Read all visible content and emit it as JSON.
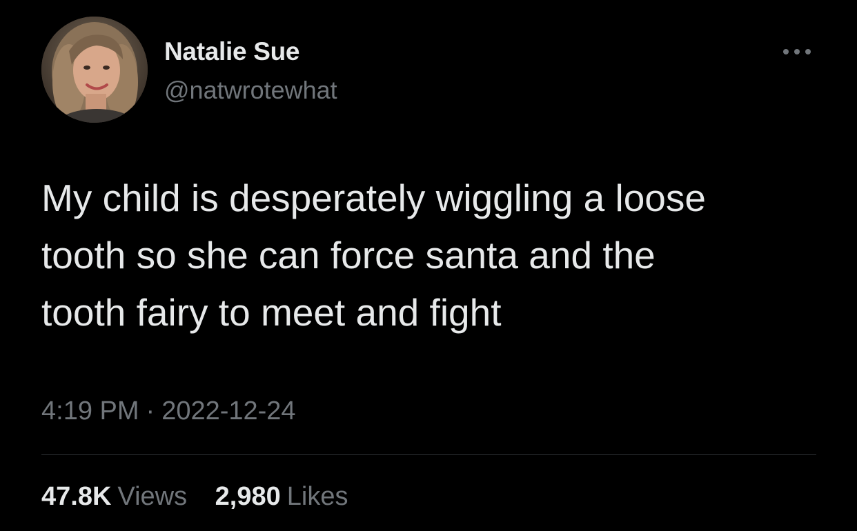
{
  "author": {
    "display_name": "Natalie Sue",
    "handle": "@natwrotewhat",
    "avatar_icon": "profile-photo"
  },
  "tweet": {
    "text": "My child is desperately wiggling a loose\ntooth so she can force santa and the\ntooth fairy to meet and fight"
  },
  "meta": {
    "time": "4:19 PM",
    "separator": "·",
    "date": "2022-12-24"
  },
  "stats": {
    "views_value": "47.8K",
    "views_label": "Views",
    "likes_value": "2,980",
    "likes_label": "Likes"
  },
  "icons": {
    "more": "more-dots-icon"
  },
  "colors": {
    "background": "#000000",
    "primary_text": "#e7e9ea",
    "secondary_text": "#71767b",
    "divider": "#2f3336"
  }
}
